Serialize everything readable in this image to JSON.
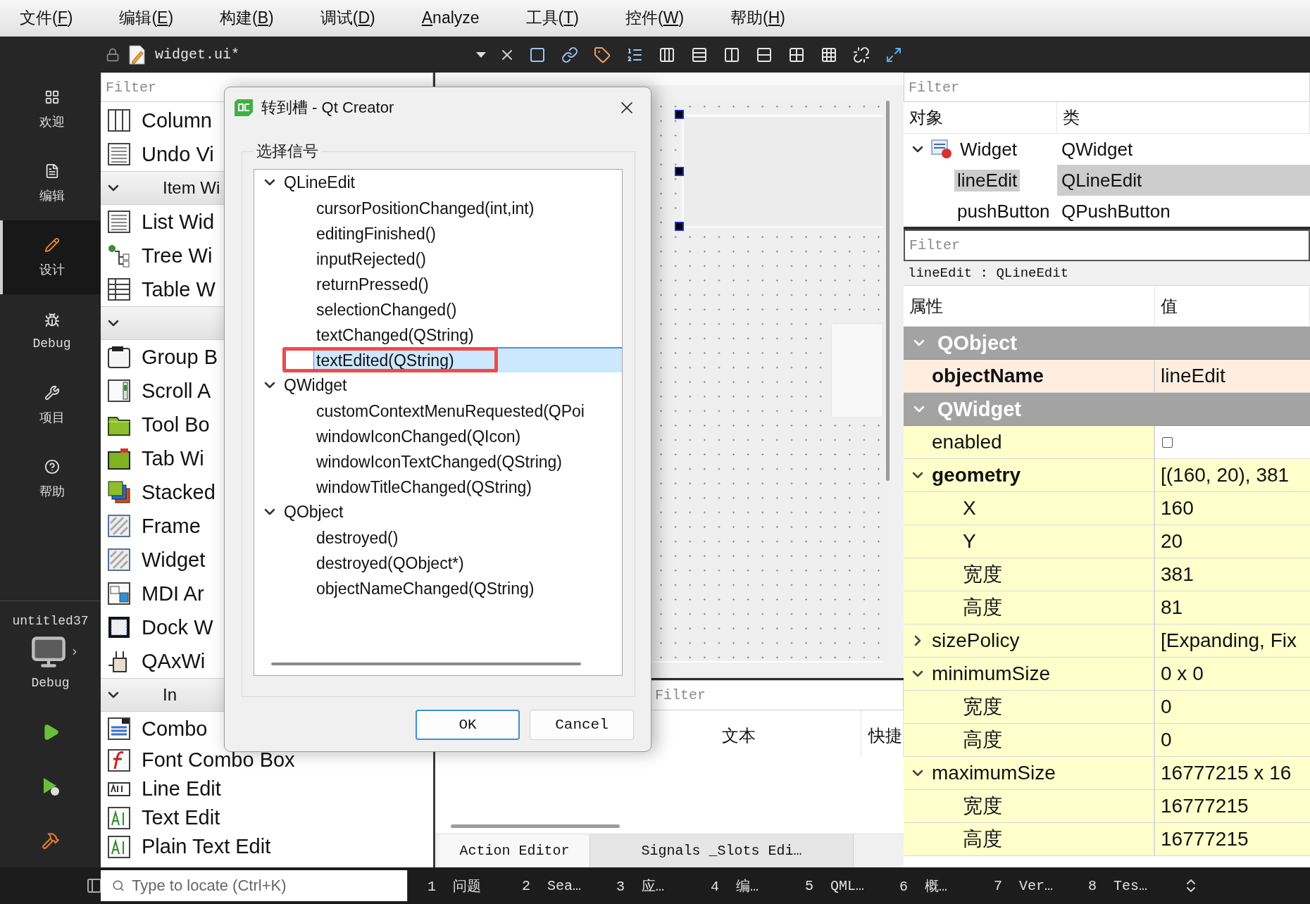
{
  "menu": [
    {
      "pre": "文件(",
      "key": "F",
      "post": ")"
    },
    {
      "pre": "编辑(",
      "key": "E",
      "post": ")"
    },
    {
      "pre": "构建(",
      "key": "B",
      "post": ")"
    },
    {
      "pre": "调试(",
      "key": "D",
      "post": ")"
    },
    {
      "key": "A",
      "post": "nalyze"
    },
    {
      "pre": "工具(",
      "key": "T",
      "post": ")"
    },
    {
      "pre": "控件(",
      "key": "W",
      "post": ")"
    },
    {
      "pre": "帮助(",
      "key": "H",
      "post": ")"
    }
  ],
  "toolbar": {
    "file": "widget.ui*"
  },
  "modes": [
    {
      "label": "欢迎",
      "kind": "welcome",
      "selected": false
    },
    {
      "label": "编辑",
      "kind": "edit",
      "selected": false
    },
    {
      "label": "设计",
      "kind": "design",
      "selected": true
    },
    {
      "label": "Debug",
      "kind": "debug",
      "selected": false
    },
    {
      "label": "项目",
      "kind": "projects",
      "selected": false
    },
    {
      "label": "帮助",
      "kind": "help",
      "selected": false
    }
  ],
  "project": {
    "name": "untitled37",
    "config": "Debug"
  },
  "widget_box": {
    "filter_placeholder": "Filter",
    "items": [
      {
        "kind": "item",
        "label": "Column"
      },
      {
        "kind": "item",
        "label": "Undo Vi"
      },
      {
        "kind": "category",
        "label": "Item Wi",
        "expanded": true
      },
      {
        "kind": "item",
        "label": "List Wid"
      },
      {
        "kind": "item",
        "label": "Tree Wi"
      },
      {
        "kind": "item",
        "label": "Table W"
      },
      {
        "kind": "category",
        "expanded": true
      },
      {
        "kind": "item",
        "label": "Group B"
      },
      {
        "kind": "item",
        "label": "Scroll A"
      },
      {
        "kind": "item",
        "label": "Tool Bo"
      },
      {
        "kind": "item",
        "label": "Tab Wi"
      },
      {
        "kind": "item",
        "label": "Stacked"
      },
      {
        "kind": "item",
        "label": "Frame"
      },
      {
        "kind": "item",
        "label": "Widget"
      },
      {
        "kind": "item",
        "label": "MDI Ar"
      },
      {
        "kind": "item",
        "label": "Dock W"
      },
      {
        "kind": "item",
        "label": "QAxWi"
      },
      {
        "kind": "category",
        "label": "In",
        "expanded": true
      },
      {
        "kind": "item",
        "label": "Combo"
      },
      {
        "kind": "item",
        "label": "Font Combo Box"
      },
      {
        "kind": "item",
        "label": "Line Edit"
      },
      {
        "kind": "item",
        "label": "Text Edit"
      },
      {
        "kind": "item",
        "label": "Plain Text Edit"
      }
    ]
  },
  "dialog": {
    "title": "转到槽 - Qt Creator",
    "group": "选择信号",
    "signals": [
      {
        "label": "QLineEdit",
        "expanded": true,
        "children": [
          {
            "label": "cursorPositionChanged(int,int)",
            "selected": false,
            "highlighted": false
          },
          {
            "label": "editingFinished()",
            "selected": false,
            "highlighted": false
          },
          {
            "label": "inputRejected()",
            "selected": false,
            "highlighted": false
          },
          {
            "label": "returnPressed()",
            "selected": false,
            "highlighted": false
          },
          {
            "label": "selectionChanged()",
            "selected": false,
            "highlighted": false
          },
          {
            "label": "textChanged(QString)",
            "selected": false,
            "highlighted": false
          },
          {
            "label": "textEdited(QString)",
            "selected": true,
            "highlighted": true
          }
        ]
      },
      {
        "label": "QWidget",
        "expanded": true,
        "children": [
          {
            "label": "customContextMenuRequested(QPoi",
            "selected": false,
            "highlighted": false
          },
          {
            "label": "windowIconChanged(QIcon)",
            "selected": false,
            "highlighted": false
          },
          {
            "label": "windowIconTextChanged(QString)",
            "selected": false,
            "highlighted": false
          },
          {
            "label": "windowTitleChanged(QString)",
            "selected": false,
            "highlighted": false
          }
        ]
      },
      {
        "label": "QObject",
        "expanded": true,
        "children": [
          {
            "label": "destroyed()",
            "selected": false,
            "highlighted": false
          },
          {
            "label": "destroyed(QObject*)",
            "selected": false,
            "highlighted": false
          },
          {
            "label": "objectNameChanged(QString)",
            "selected": false,
            "highlighted": false
          }
        ]
      }
    ],
    "buttons": [
      {
        "label": "OK",
        "default": true
      },
      {
        "label": "Cancel",
        "default": false
      }
    ]
  },
  "action_editor": {
    "filter_placeholder": "Filter",
    "columns": [
      "文本",
      "快捷"
    ],
    "tabs": [
      {
        "label": "Action Editor",
        "selected": true
      },
      {
        "label": "Signals _Slots Edi…",
        "selected": false
      }
    ]
  },
  "object_inspector": {
    "filter_placeholder": "Filter",
    "columns": [
      "对象",
      "类"
    ],
    "tree": [
      {
        "name": "Widget",
        "class": "QWidget",
        "expanded": true,
        "selected": false,
        "children": [
          {
            "name": "lineEdit",
            "class": "QLineEdit",
            "selected": true
          },
          {
            "name": "pushButton",
            "class": "QPushButton",
            "selected": false
          }
        ]
      }
    ]
  },
  "property_editor": {
    "filter_placeholder": "Filter",
    "object": "lineEdit : QLineEdit",
    "columns": [
      "属性",
      "值"
    ],
    "groups": [
      {
        "name": "QObject",
        "expanded": true,
        "color": "#fdeee0",
        "children": [
          {
            "kind": "text",
            "name": "objectName",
            "value": "lineEdit",
            "modified": true
          }
        ]
      },
      {
        "name": "QWidget",
        "expanded": true,
        "color": "#ffffcc",
        "children": [
          {
            "kind": "checkbox",
            "name": "enabled",
            "checked": false,
            "modified": false
          },
          {
            "kind": "text",
            "name": "geometry",
            "value": "[(160, 20), 381",
            "modified": true,
            "expanded": true,
            "children": [
              {
                "kind": "text",
                "name": "X",
                "value": "160",
                "modified": false
              },
              {
                "kind": "text",
                "name": "Y",
                "value": "20",
                "modified": false
              },
              {
                "kind": "text",
                "name": "宽度",
                "value": "381",
                "modified": false
              },
              {
                "kind": "text",
                "name": "高度",
                "value": "81",
                "modified": false
              }
            ]
          },
          {
            "kind": "text",
            "name": "sizePolicy",
            "value": "[Expanding, Fix",
            "modified": false,
            "expanded": false
          },
          {
            "kind": "text",
            "name": "minimumSize",
            "value": "0 x 0",
            "modified": false,
            "expanded": true,
            "children": [
              {
                "kind": "text",
                "name": "宽度",
                "value": "0",
                "modified": false
              },
              {
                "kind": "text",
                "name": "高度",
                "value": "0",
                "modified": false
              }
            ]
          },
          {
            "kind": "text",
            "name": "maximumSize",
            "value": "16777215 x 16",
            "modified": false,
            "expanded": true,
            "children": [
              {
                "kind": "text",
                "name": "宽度",
                "value": "16777215",
                "modified": false
              },
              {
                "kind": "text",
                "name": "高度",
                "value": "16777215",
                "modified": false
              }
            ]
          }
        ]
      }
    ]
  },
  "status_bar": {
    "locate_placeholder": "Type to locate (Ctrl+K)",
    "panes": [
      {
        "number": "1",
        "label": "问题"
      },
      {
        "number": "2",
        "label": "Sea…"
      },
      {
        "number": "3",
        "label": "应…"
      },
      {
        "number": "4",
        "label": "编…"
      },
      {
        "number": "5",
        "label": "QML…"
      },
      {
        "number": "6",
        "label": "概…"
      },
      {
        "number": "7",
        "label": "Ver…"
      },
      {
        "number": "8",
        "label": "Tes…"
      }
    ]
  }
}
